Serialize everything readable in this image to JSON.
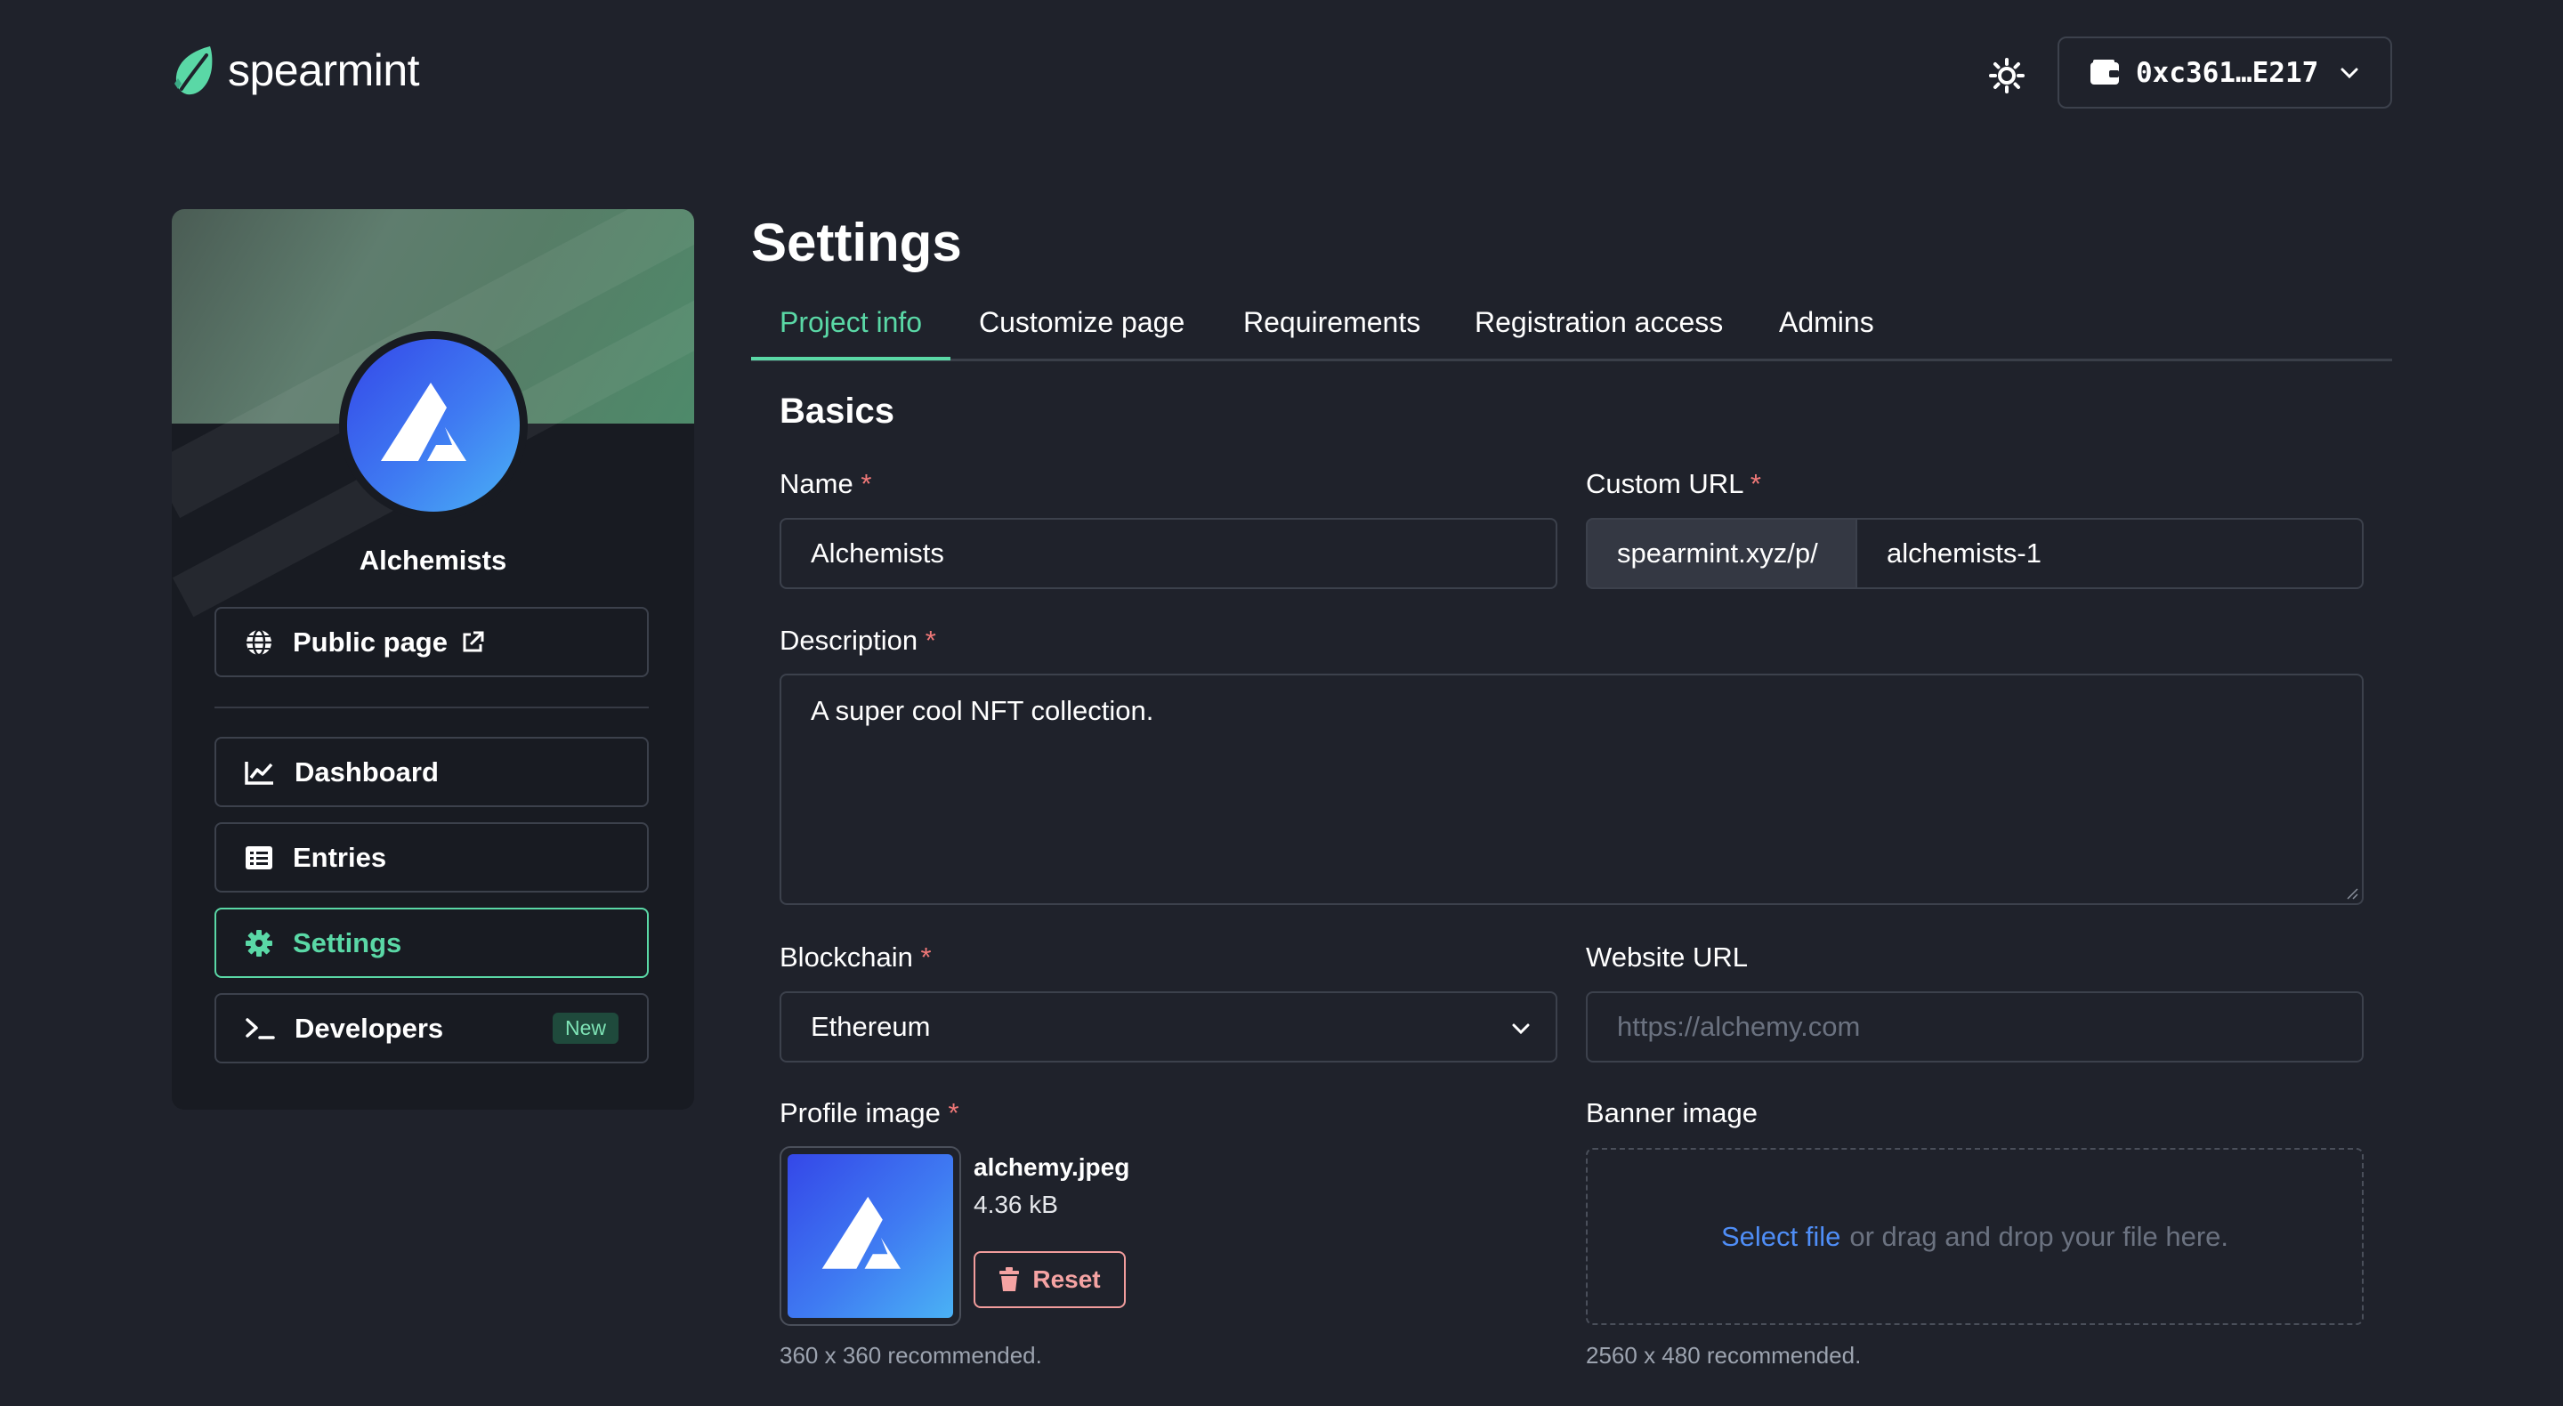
{
  "app": {
    "name": "spearmint"
  },
  "header": {
    "wallet_address": "0xc361…E217"
  },
  "project": {
    "name": "Alchemists",
    "public_page_label": "Public page"
  },
  "sidebar": {
    "items": [
      {
        "label": "Dashboard",
        "icon": "chart-line-icon"
      },
      {
        "label": "Entries",
        "icon": "list-icon"
      },
      {
        "label": "Settings",
        "icon": "gear-icon",
        "active": true
      },
      {
        "label": "Developers",
        "icon": "terminal-icon",
        "badge": "New"
      }
    ]
  },
  "page": {
    "title": "Settings",
    "tabs": [
      {
        "label": "Project info",
        "active": true
      },
      {
        "label": "Customize page"
      },
      {
        "label": "Requirements"
      },
      {
        "label": "Registration access"
      },
      {
        "label": "Admins"
      }
    ]
  },
  "form": {
    "section_title": "Basics",
    "required_mark": "*",
    "name": {
      "label": "Name",
      "value": "Alchemists"
    },
    "custom_url": {
      "label": "Custom URL",
      "prefix": "spearmint.xyz/p/",
      "value": "alchemists-1"
    },
    "description": {
      "label": "Description",
      "value": "A super cool NFT collection."
    },
    "blockchain": {
      "label": "Blockchain",
      "value": "Ethereum"
    },
    "website_url": {
      "label": "Website URL",
      "placeholder": "https://alchemy.com"
    },
    "profile_image": {
      "label": "Profile image",
      "file_name": "alchemy.jpeg",
      "file_size": "4.36 kB",
      "reset_label": "Reset",
      "hint": "360 x 360 recommended."
    },
    "banner_image": {
      "label": "Banner image",
      "select_label": "Select file",
      "drop_text": "or drag and drop your file here.",
      "hint": "2560 x 480 recommended."
    }
  },
  "colors": {
    "background": "#1f222b",
    "accent": "#5ad8a6",
    "danger": "#f07878",
    "link": "#4f8ef7"
  }
}
